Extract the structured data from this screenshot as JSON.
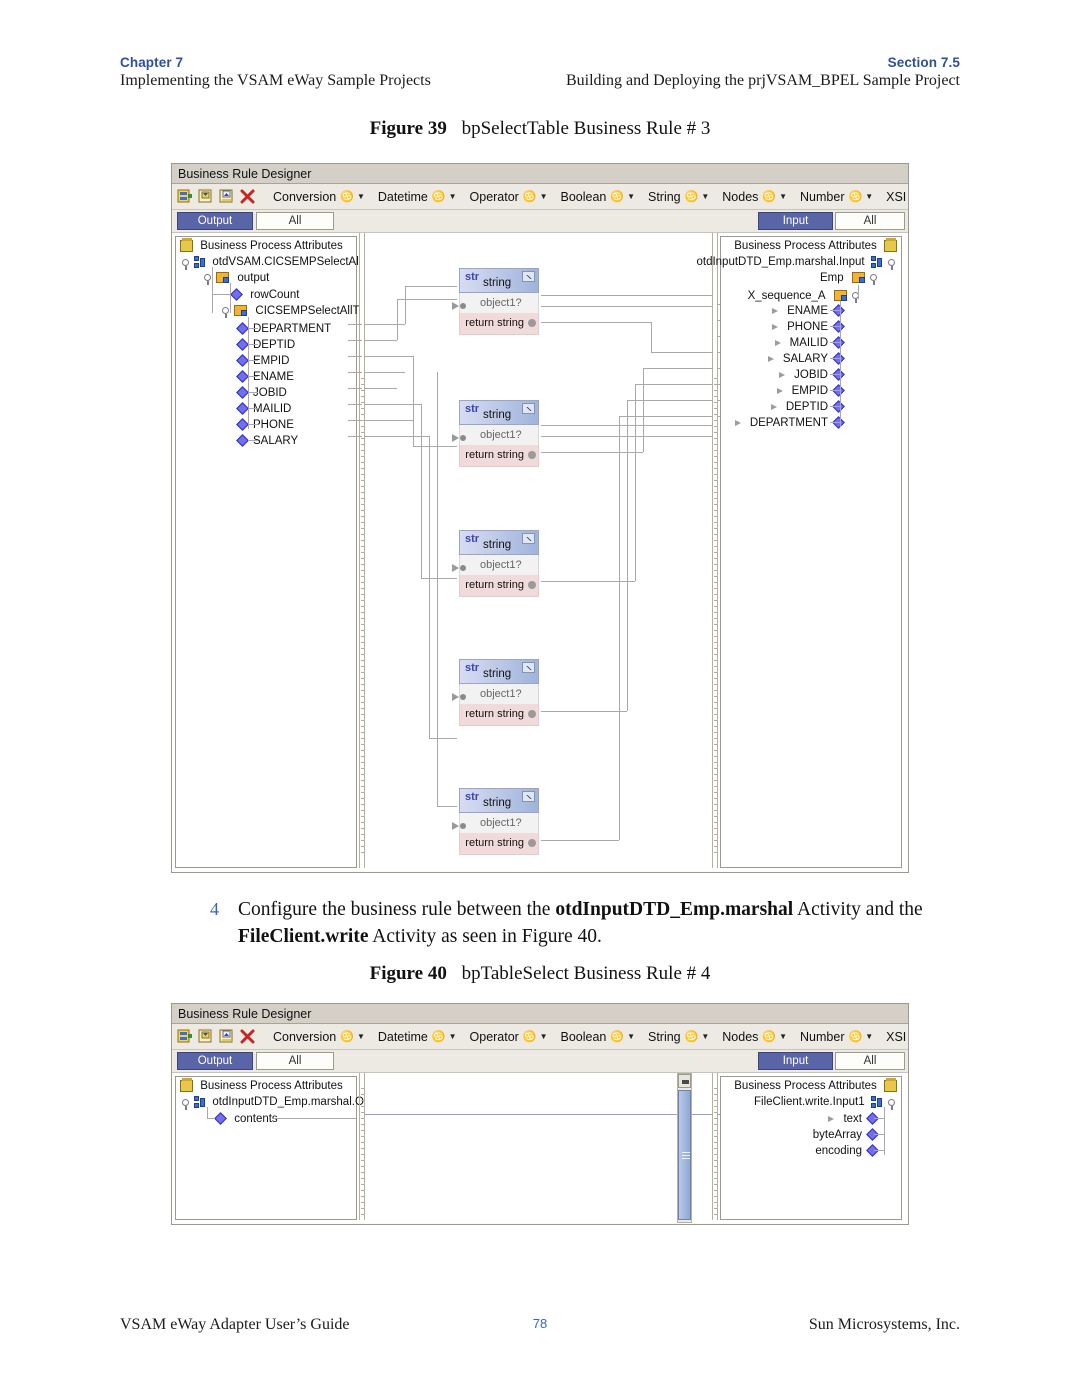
{
  "header": {
    "left_tag": "Chapter 7",
    "left_sub": "Implementing the VSAM eWay Sample Projects",
    "right_tag": "Section 7.5",
    "right_sub": "Building and Deploying the prjVSAM_BPEL Sample Project"
  },
  "figure39": {
    "caption_label": "Figure 39",
    "caption_text": "bpSelectTable Business Rule # 3",
    "window_title": "Business Rule Designer",
    "toolbar": {
      "menus": [
        "Conversion",
        "Datetime",
        "Operator",
        "Boolean",
        "String",
        "Nodes",
        "Number",
        "XSI"
      ],
      "icons": [
        "new-rule-icon",
        "copy-rule-icon",
        "paste-rule-icon",
        "delete-rule-icon"
      ]
    },
    "tabs": {
      "output_label": "Output",
      "output_all": "All",
      "input_label": "Input",
      "input_all": "All"
    },
    "left_tree": {
      "root": "Business Process Attributes",
      "nodes": [
        "otdVSAM.CICSEMPSelectAl",
        "output",
        "rowCount",
        "CICSEMPSelectAllT"
      ],
      "fields": [
        "DEPARTMENT",
        "DEPTID",
        "EMPID",
        "ENAME",
        "JOBID",
        "MAILID",
        "PHONE",
        "SALARY"
      ]
    },
    "right_tree": {
      "root": "Business Process Attributes",
      "nodes": [
        "otdInputDTD_Emp.marshal.Input",
        "Emp",
        "X_sequence_A"
      ],
      "fields": [
        "ENAME",
        "PHONE",
        "MAILID",
        "SALARY",
        "JOBID",
        "EMPID",
        "DEPTID",
        "DEPARTMENT"
      ]
    },
    "function_nodes": [
      {
        "type_tag": "str",
        "title": "string",
        "input": "object1?",
        "output": "return string"
      },
      {
        "type_tag": "str",
        "title": "string",
        "input": "object1?",
        "output": "return string"
      },
      {
        "type_tag": "str",
        "title": "string",
        "input": "object1?",
        "output": "return string"
      },
      {
        "type_tag": "str",
        "title": "string",
        "input": "object1?",
        "output": "return string"
      },
      {
        "type_tag": "str",
        "title": "string",
        "input": "object1?",
        "output": "return string"
      }
    ]
  },
  "step": {
    "number": "4",
    "part1": "Configure the business rule between the ",
    "bold1": "otdInputDTD_Emp.marshal",
    "part2": " Activity and the ",
    "bold2": "FileClient.write",
    "part3": " Activity as seen in Figure 40."
  },
  "figure40": {
    "caption_label": "Figure 40",
    "caption_text": "bpTableSelect Business Rule # 4",
    "window_title": "Business Rule Designer",
    "toolbar": {
      "menus": [
        "Conversion",
        "Datetime",
        "Operator",
        "Boolean",
        "String",
        "Nodes",
        "Number",
        "XSI"
      ],
      "icons": [
        "new-rule-icon",
        "copy-rule-icon",
        "paste-rule-icon",
        "delete-rule-icon"
      ]
    },
    "tabs": {
      "output_label": "Output",
      "output_all": "All",
      "input_label": "Input",
      "input_all": "All"
    },
    "left_tree": {
      "root": "Business Process Attributes",
      "nodes": [
        "otdInputDTD_Emp.marshal.O"
      ],
      "fields": [
        "contents"
      ]
    },
    "right_tree": {
      "root": "Business Process Attributes",
      "nodes": [
        "FileClient.write.Input1"
      ],
      "fields": [
        "text",
        "byteArray",
        "encoding"
      ]
    }
  },
  "footer": {
    "left": "VSAM eWay Adapter User’s Guide",
    "page": "78",
    "right": "Sun Microsystems, Inc."
  },
  "colors": {
    "accent_blue": "#2d4fa2",
    "tab_selected": "#5a65a8",
    "node_header_start": "#d8dcf2",
    "node_header_end": "#9fb4dc",
    "node_return": "#f0dada",
    "window_title_bar": "#d4d0c8"
  }
}
